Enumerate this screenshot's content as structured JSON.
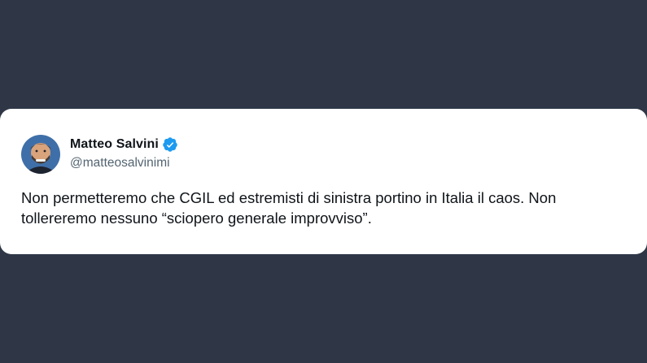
{
  "tweet": {
    "author_name": "Matteo Salvini",
    "handle": "@matteosalvinimi",
    "verified": true,
    "text": "Non permetteremo che CGIL ed estremisti di sinistra portino in Italia il caos. Non tollereremo nessuno “sciopero generale improvviso”."
  },
  "colors": {
    "background": "#2f3747",
    "card": "#ffffff",
    "name": "#0f1419",
    "handle": "#536471",
    "verified_badge": "#1d9bf0"
  },
  "icons": {
    "avatar": "profile-photo",
    "verified": "verified-badge-icon"
  }
}
